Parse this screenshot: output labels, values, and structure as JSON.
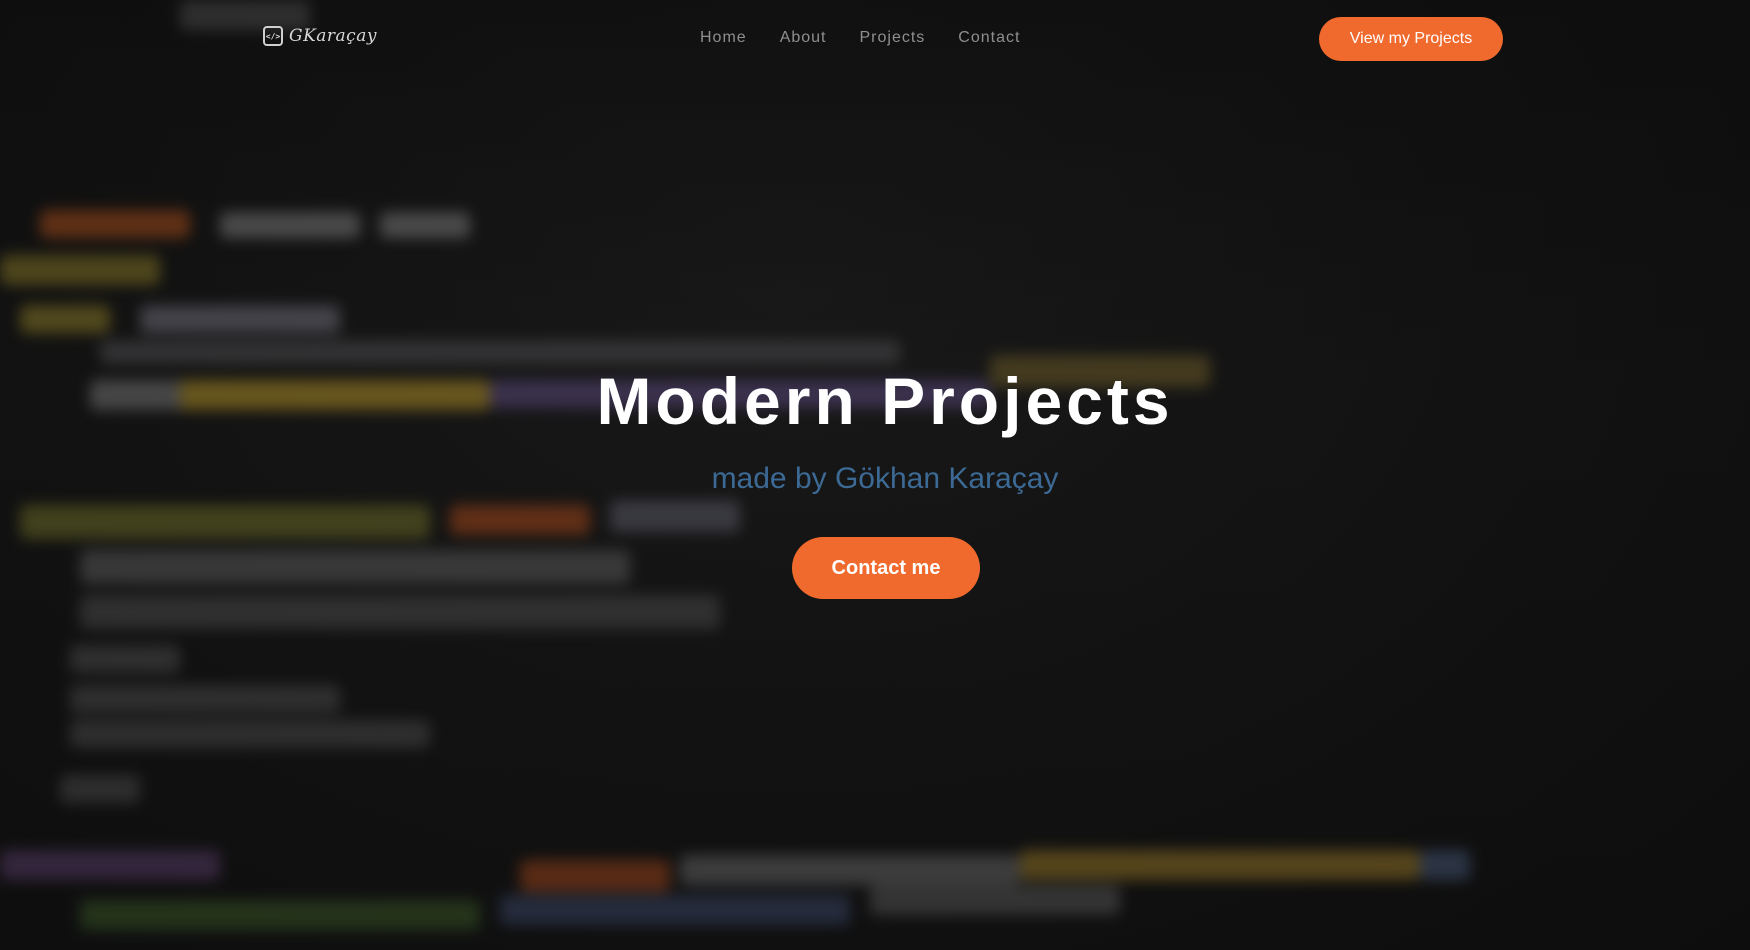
{
  "brand": {
    "logo_icon": "code-icon",
    "logo_text": "GKaraçay"
  },
  "nav": {
    "items": [
      {
        "label": "Home"
      },
      {
        "label": "About"
      },
      {
        "label": "Projects"
      },
      {
        "label": "Contact"
      }
    ],
    "cta_label": "View my Projects"
  },
  "hero": {
    "title": "Modern Projects",
    "subtitle": "made by Gökhan Karaçay",
    "cta_label": "Contact me"
  },
  "colors": {
    "accent": "#f06a2e",
    "subtitle": "#3c6a95",
    "background": "#151515",
    "nav_text": "#8f8f8f"
  }
}
